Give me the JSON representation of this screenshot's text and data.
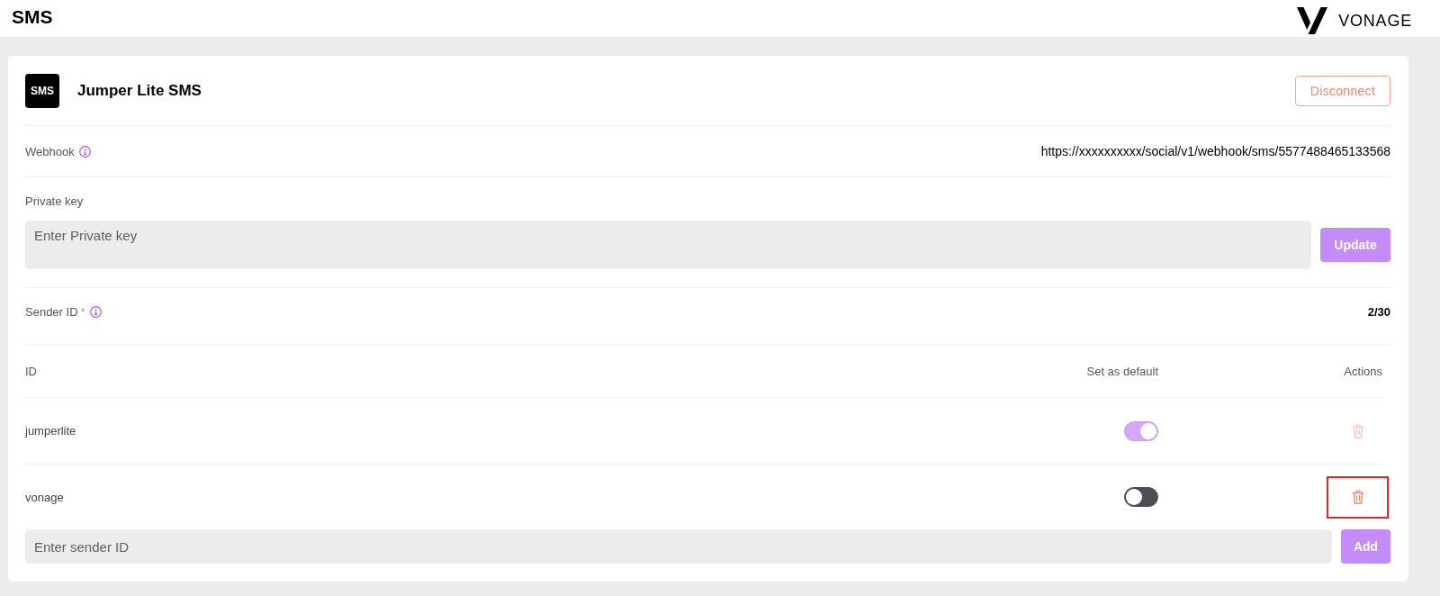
{
  "header": {
    "title": "SMS",
    "brand": "VONAGE"
  },
  "integration": {
    "badge": "SMS",
    "name": "Jumper Lite SMS",
    "disconnect": "Disconnect"
  },
  "webhook": {
    "label": "Webhook",
    "value": "https://xxxxxxxxxx/social/v1/webhook/sms/5577488465133568"
  },
  "private_key": {
    "label": "Private key",
    "placeholder": "Enter Private key",
    "button": "Update"
  },
  "sender_id": {
    "label": "Sender ID",
    "required_mark": "*",
    "count": "2/30"
  },
  "table": {
    "columns": [
      "ID",
      "Set as default",
      "Actions"
    ],
    "rows": [
      {
        "id": "jumperlite",
        "on": true,
        "disabled": true,
        "highlighted": false
      },
      {
        "id": "vonage",
        "on": false,
        "disabled": false,
        "highlighted": true
      }
    ]
  },
  "add_sender": {
    "placeholder": "Enter sender ID",
    "button": "Add"
  }
}
